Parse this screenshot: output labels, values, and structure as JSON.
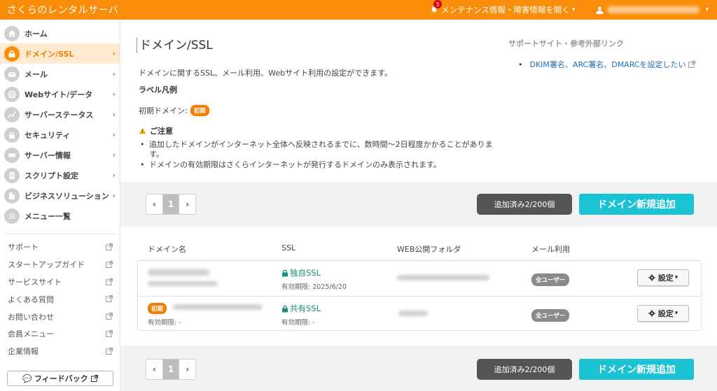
{
  "header": {
    "brand": "さくらのレンタルサーバ",
    "notification_count": "5",
    "notice_label": "メンテナンス情報・障害情報を開く"
  },
  "sidebar": {
    "items": [
      {
        "label": "ホーム",
        "icon": "home-icon",
        "active": false
      },
      {
        "label": "ドメイン/SSL",
        "icon": "domain-icon",
        "active": true
      },
      {
        "label": "メール",
        "icon": "mail-icon",
        "active": false
      },
      {
        "label": "Webサイト/データ",
        "icon": "globe-icon",
        "active": false
      },
      {
        "label": "サーバーステータス",
        "icon": "chart-icon",
        "active": false
      },
      {
        "label": "セキュリティ",
        "icon": "lock-icon",
        "active": false
      },
      {
        "label": "サーバー情報",
        "icon": "server-icon",
        "active": false
      },
      {
        "label": "スクリプト設定",
        "icon": "script-icon",
        "active": false
      },
      {
        "label": "ビジネスソリューション",
        "icon": "building-icon",
        "active": false
      },
      {
        "label": "メニュー一覧",
        "icon": "menu-list-icon",
        "active": false
      }
    ],
    "links": [
      "サポート",
      "スタートアップガイド",
      "サービスサイト",
      "よくある質問",
      "お問い合わせ",
      "会員メニュー",
      "企業情報"
    ],
    "feedback_label": "フィードバック"
  },
  "main": {
    "title": "ドメイン/SSL",
    "description": "ドメインに関するSSL、メール利用、Webサイト利用の設定ができます。",
    "legend_title": "ラベル凡例",
    "legend_label": "初期ドメイン:",
    "legend_badge": "初期",
    "warning_title": "ご注意",
    "warnings": [
      "追加したドメインがインターネット全体へ反映されるまでに、数時間〜2日程度かかることがあります。",
      "ドメインの有効期限はさくらインターネットが発行するドメインのみ表示されます。"
    ],
    "support_title": "サポートサイト・参考外部リンク",
    "support_link": "DKIM署名、ARC署名、DMARCを設定したい"
  },
  "toolbar": {
    "page_current": "1",
    "count_label": "追加済み2/200個",
    "add_label": "ドメイン新規追加"
  },
  "table": {
    "headers": [
      "ドメイン名",
      "SSL",
      "WEB公開フォルダ",
      "メール利用"
    ],
    "rows": [
      {
        "ssl": "独自SSL",
        "ssl_expiry": "有効期限: 2025/6/20",
        "mail": "全ユーザー",
        "settings": "設定",
        "initial": false,
        "domain_expiry": ""
      },
      {
        "ssl": "共有SSL",
        "ssl_expiry": "有効期限: -",
        "mail": "全ユーザー",
        "settings": "設定",
        "initial": true,
        "badge": "初期",
        "domain_expiry": "有効期限: -"
      }
    ]
  },
  "colors": {
    "brand": "#f98d0a",
    "accent": "#19c3d3",
    "ssl": "#1a8f7d",
    "link": "#1f6fb4"
  }
}
